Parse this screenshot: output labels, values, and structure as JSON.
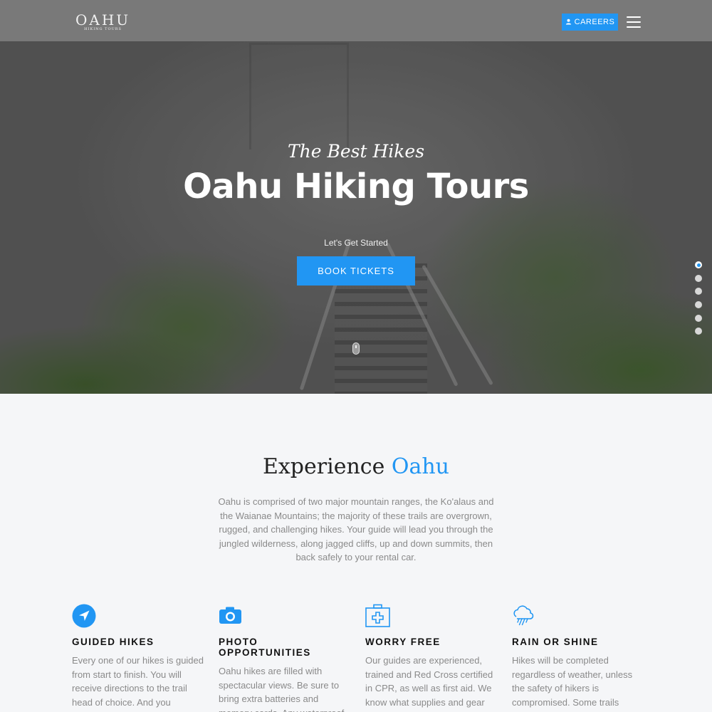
{
  "header": {
    "logo": {
      "title": "OAHU",
      "subtitle": "HIKING TOURS"
    },
    "careers_label": "CAREERS",
    "careers_icon": "user-icon",
    "menu_icon": "hamburger-menu-icon"
  },
  "hero": {
    "subtitle": "The Best Hikes",
    "title": "Oahu Hiking Tours",
    "cta_text": "Let's Get Started",
    "button_label": "BOOK TICKETS",
    "scroll_icon": "mouse-scroll-icon",
    "slide_count": 6,
    "active_slide": 1
  },
  "intro": {
    "title_plain": "Experience ",
    "title_accent": "Oahu",
    "body": "Oahu is comprised of two major mountain ranges, the Ko'alaus and the Waianae Mountains; the majority of these trails are overgrown, rugged, and challenging hikes. Your guide will lead you through the jungled wilderness, along jagged cliffs, up and down summits, then back safely to your rental car."
  },
  "features": [
    {
      "icon": "navigation-arrow-icon",
      "title": "GUIDED HIKES",
      "text": "Every one of our hikes is guided from start to finish. You will receive directions to the trail head of choice. And you"
    },
    {
      "icon": "camera-icon",
      "title": "PHOTO OPPORTUNITIES",
      "text": "Oahu hikes are filled with spectacular views. Be sure to bring extra batteries and memory cards. Any waterproof"
    },
    {
      "icon": "first-aid-kit-icon",
      "title": "WORRY FREE",
      "text": "Our guides are experienced, trained and Red Cross certified in CPR, as well as first aid. We know what supplies and gear"
    },
    {
      "icon": "rain-cloud-icon",
      "title": "RAIN OR SHINE",
      "text": "Hikes will be completed regardless of weather, unless the safety of hikers is compromised. Some trails"
    }
  ],
  "colors": {
    "accent": "#2196f3",
    "heading": "#222222",
    "body_text": "#8a8a8a",
    "page_bg": "#f5f6f8"
  }
}
